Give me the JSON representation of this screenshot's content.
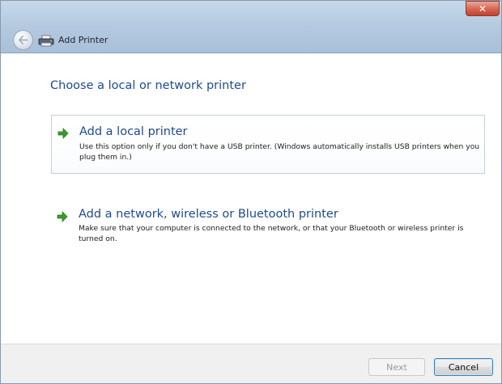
{
  "window": {
    "title": "Add Printer",
    "close_glyph": "✕"
  },
  "main": {
    "heading": "Choose a local or network printer",
    "options": [
      {
        "title": "Add a local printer",
        "description": "Use this option only if you don't have a USB printer. (Windows automatically installs USB printers when you plug them in.)",
        "icon": "green-arrow-icon"
      },
      {
        "title": "Add a network, wireless or Bluetooth printer",
        "description": "Make sure that your computer is connected to the network, or that your Bluetooth or wireless printer is turned on.",
        "icon": "green-arrow-icon"
      }
    ]
  },
  "footer": {
    "next_label": "Next",
    "cancel_label": "Cancel"
  },
  "colors": {
    "accent_text": "#1f4b8a",
    "arrow_green": "#3a9a2c",
    "close_red": "#c2412d"
  }
}
